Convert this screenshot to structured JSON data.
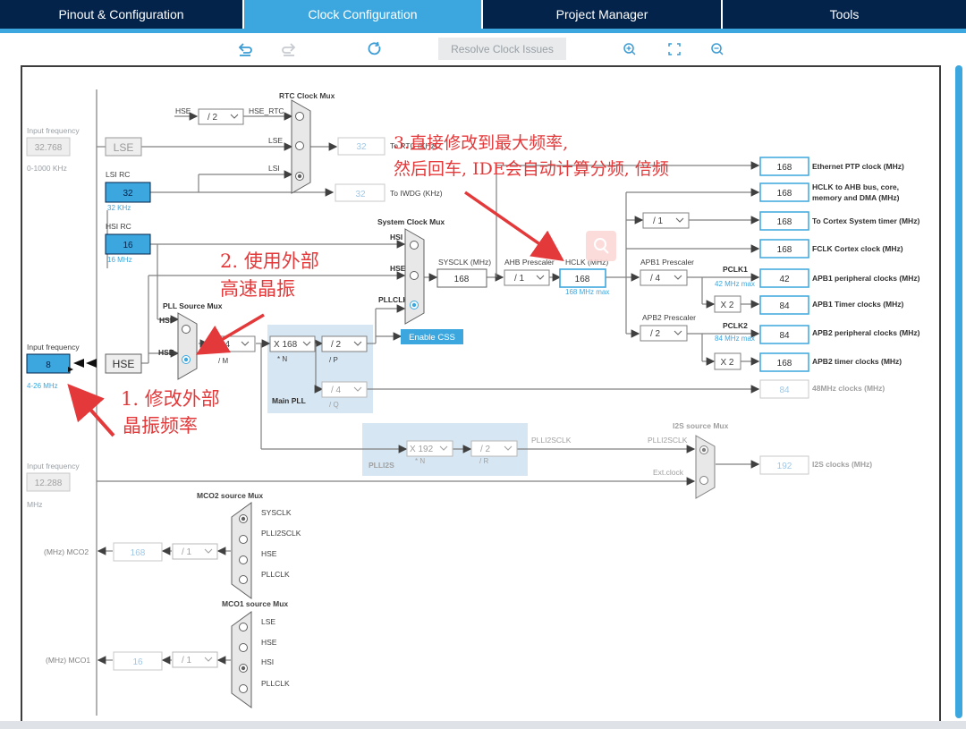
{
  "tabs": [
    {
      "label": "Pinout & Configuration"
    },
    {
      "label": "Clock Configuration"
    },
    {
      "label": "Project Manager"
    },
    {
      "label": "Tools"
    }
  ],
  "toolbar": {
    "undo_icon": "undo-icon",
    "redo_icon": "redo-icon",
    "refresh_icon": "refresh-icon",
    "resolve_label": "Resolve Clock Issues",
    "zoom_in_icon": "zoom-in-icon",
    "fit_icon": "fit-screen-icon",
    "zoom_out_icon": "zoom-out-icon"
  },
  "colors": {
    "accent": "#3ca7de",
    "nav": "#03234b",
    "annotation": "#e3393a",
    "line": "#808080"
  },
  "left": {
    "lse_input_label": "Input frequency",
    "lse_input_value": "32.768",
    "lse_range": "0-1000 KHz",
    "lse_label": "LSE",
    "lsi_rc_label": "LSI RC",
    "lsi_value": "32",
    "lsi_unit": "32 KHz",
    "hsi_rc_label": "HSI RC",
    "hsi_value": "16",
    "hsi_unit": "16 MHz",
    "hse_input_label": "Input frequency",
    "hse_input_value": "8",
    "hse_range": "4-26 MHz",
    "hse_label": "HSE",
    "i2s_input_label": "Input frequency",
    "i2s_input_value": "12.288",
    "i2s_unit": "MHz"
  },
  "rtc": {
    "mux_label": "RTC Clock Mux",
    "hse_label": "HSE",
    "div": "/ 2",
    "hse_rtc": "HSE_RTC",
    "lse": "LSE",
    "lsi": "LSI",
    "rtc_value": "32",
    "rtc_out": "To RTC (KHz)",
    "iwdg_value": "32",
    "iwdg_out": "To IWDG (KHz)"
  },
  "pll": {
    "source_mux_label": "PLL Source Mux",
    "hsi": "HSI",
    "hse": "HSE",
    "m_value": "/ 4",
    "m_label": "/ M",
    "n_value": "X 168",
    "n_label": "* N",
    "p_value": "/ 2",
    "p_label": "/ P",
    "q_value": "/ 4",
    "q_label": "/ Q",
    "main_pll_label": "Main PLL"
  },
  "sys": {
    "mux_label": "System Clock Mux",
    "hsi": "HSI",
    "hse": "HSE",
    "pllclk": "PLLCLK",
    "enable_css": "Enable CSS",
    "sysclk_label": "SYSCLK (MHz)",
    "sysclk_value": "168",
    "ahb_label": "AHB Prescaler",
    "ahb_value": "/ 1",
    "hclk_label": "HCLK (MHz)",
    "hclk_value": "168",
    "hclk_max": "168 MHz max",
    "apb1_label": "APB1 Prescaler",
    "apb1_value": "/ 4",
    "pclk1": "PCLK1",
    "pclk1_max": "42 MHz max",
    "apb2_label": "APB2 Prescaler",
    "apb2_value": "/ 2",
    "pclk2": "PCLK2",
    "pclk2_max": "84 MHz max",
    "cortex_div": "/ 1",
    "x2_a": "X 2",
    "x2_b": "X 2"
  },
  "outputs": [
    {
      "value": "168",
      "label": "Ethernet PTP clock (MHz)"
    },
    {
      "value": "168",
      "label": "HCLK to AHB bus, core,",
      "label2": "memory and DMA (MHz)"
    },
    {
      "value": "168",
      "label": "To Cortex System timer (MHz)"
    },
    {
      "value": "168",
      "label": "FCLK Cortex clock (MHz)"
    },
    {
      "value": "42",
      "label": "APB1 peripheral clocks (MHz)"
    },
    {
      "value": "84",
      "label": "APB1 Timer clocks (MHz)"
    },
    {
      "value": "84",
      "label": "APB2 peripheral clocks (MHz)"
    },
    {
      "value": "168",
      "label": "APB2 timer clocks (MHz)"
    },
    {
      "value": "84",
      "label": "48MHz clocks (MHz)"
    },
    {
      "value": "192",
      "label": "I2S clocks (MHz)"
    }
  ],
  "plli2s": {
    "label": "PLLI2S",
    "n_value": "X 192",
    "n_label": "* N",
    "r_value": "/ 2",
    "r_label": "/ R",
    "plli2sclk": "PLLI2SCLK",
    "mux_label": "I2S source Mux",
    "mux_in1": "PLLI2SCLK",
    "mux_in2": "Ext.clock"
  },
  "mco2": {
    "mux_label": "MCO2 source Mux",
    "sysclk": "SYSCLK",
    "plli2sclk": "PLLI2SCLK",
    "hse": "HSE",
    "pllclk": "PLLCLK",
    "div": "/ 1",
    "value": "168",
    "label": "(MHz) MCO2"
  },
  "mco1": {
    "mux_label": "MCO1 source Mux",
    "lse": "LSE",
    "hse": "HSE",
    "hsi": "HSI",
    "pllclk": "PLLCLK",
    "div": "/ 1",
    "value": "16",
    "label": "(MHz) MCO1"
  },
  "annotations": {
    "a1_line1": "1. 修改外部",
    "a1_line2": "晶振频率",
    "a2_line1": "2. 使用外部",
    "a2_line2": "高速晶振",
    "a3_line1": "3.直接修改到最大频率,",
    "a3_line2": "然后回车, IDE会自动计算分频, 倍频"
  }
}
